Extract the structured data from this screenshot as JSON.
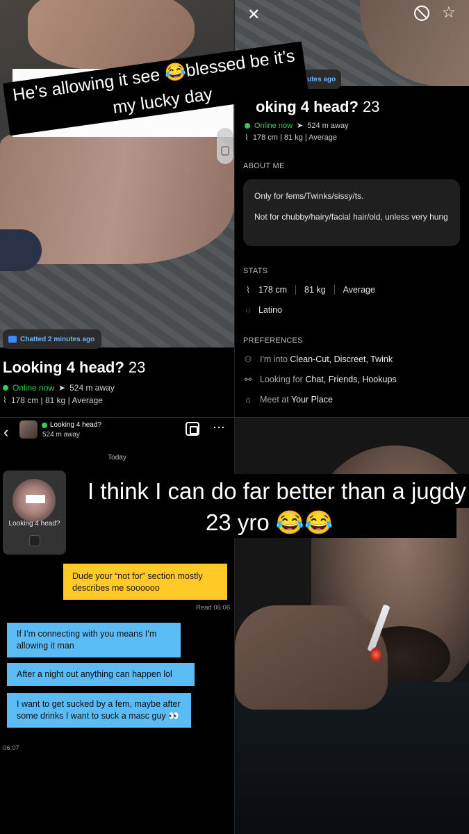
{
  "top_left": {
    "chatted_badge": "Chatted 2 minutes ago",
    "profile_name": "Looking 4 head?",
    "age": "23",
    "online": "Online now",
    "distance": "524 m away",
    "stats_line": "178 cm | 81 kg | Average",
    "caption_line1": "He’s allowing it see 😂blessed be it’s",
    "caption_line2": "my lucky day"
  },
  "top_right": {
    "badge": "2 minutes ago",
    "profile_name_partial": "oking 4 head?",
    "age": "23",
    "online": "Online now",
    "distance": "524 m away",
    "stats_line": "178 cm | 81 kg | Average",
    "about_header": "ABOUT ME",
    "about_line1": "Only for fems/Twinks/sissy/ts.",
    "about_line2": "Not for chubby/hairy/facial hair/old, unless very hung",
    "stats_header": "STATS",
    "height": "178 cm",
    "weight": "81 kg",
    "body_type": "Average",
    "ethnicity": "Latino",
    "preferences_header": "PREFERENCES",
    "into_label": "I'm into",
    "into_value": "Clean-Cut, Discreet, Twink",
    "looking_label": "Looking for",
    "looking_value": "Chat, Friends, Hookups",
    "meet_label": "Meet at",
    "meet_value": "Your Place"
  },
  "chat": {
    "header_name": "Looking 4 head?",
    "header_distance": "524 m away",
    "date_divider": "Today",
    "photo_card_label": "Looking 4 head?",
    "sent_message": "Dude your “not for” section mostly describes me soooooo",
    "read_receipt": "Read 06:06",
    "received": [
      "If I’m connecting with you means I’m allowing it man",
      "After a night out anything can happen lol",
      "I want to get sucked by a fem, maybe after some drinks I want to suck a masc guy 👀"
    ],
    "received_time": "06:07"
  },
  "bottom_right": {
    "caption_line1": "I think I can do far better than a jugdy",
    "caption_line2": "23 yro 😂😂"
  },
  "colors": {
    "online_green": "#33cc55",
    "badge_blue": "#6fb3ff",
    "sent_bubble": "#ffc926",
    "received_bubble": "#5bbcf5"
  },
  "icons": [
    "close-icon",
    "block-icon",
    "star-icon",
    "chat-bubble-icon",
    "location-arrow-icon",
    "tag-icon",
    "globe-icon",
    "people-icon",
    "handshake-icon",
    "home-icon",
    "back-chevron-icon",
    "album-icon",
    "more-icon"
  ]
}
